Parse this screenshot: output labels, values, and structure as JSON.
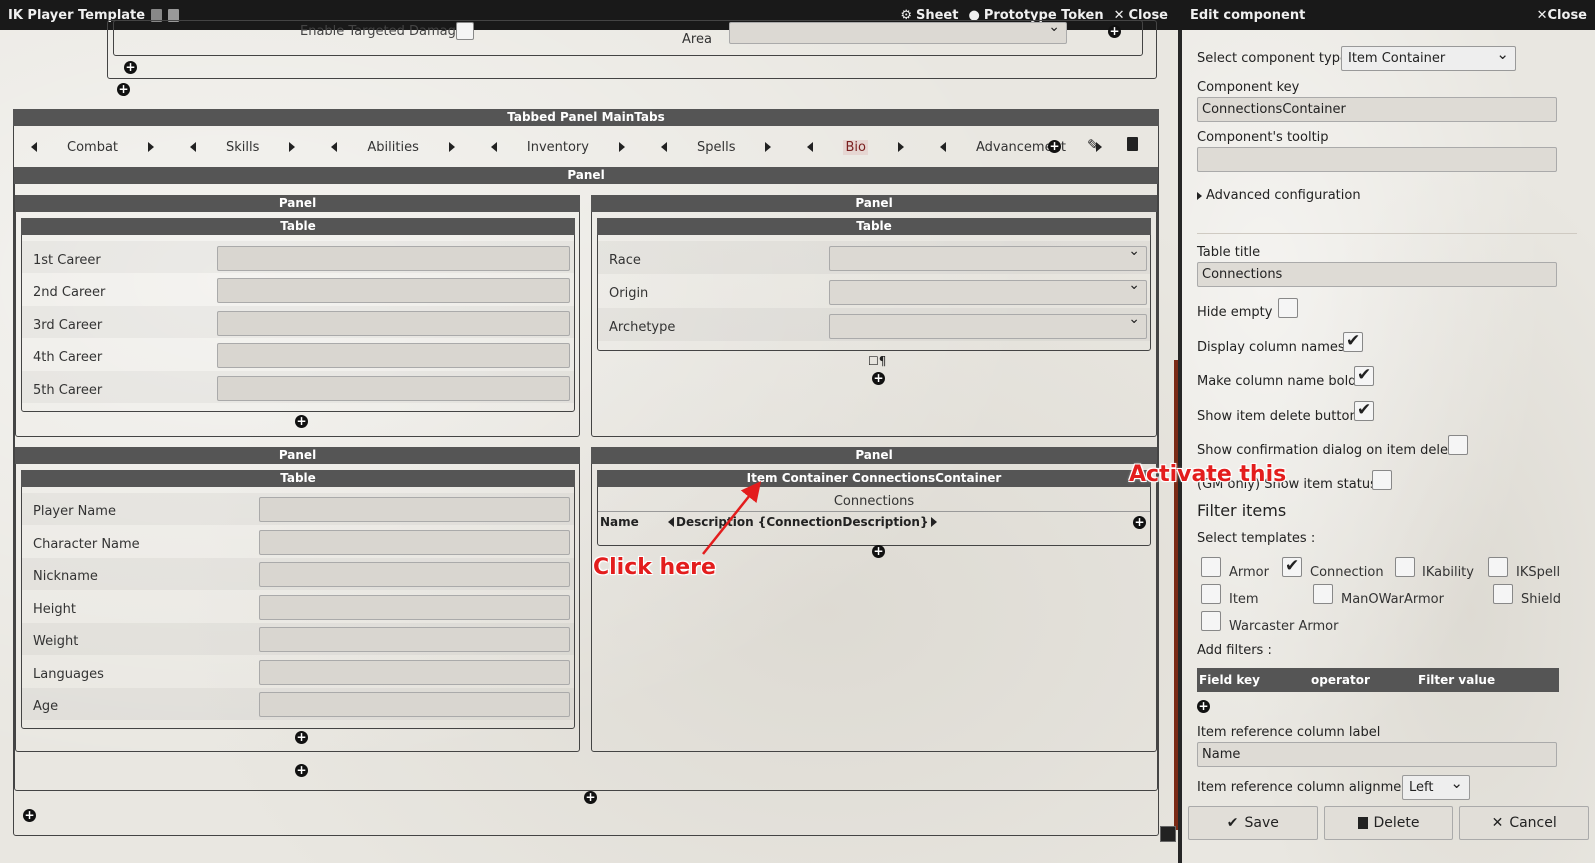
{
  "window": {
    "title": "IK Player Template",
    "sheet_label": "Sheet",
    "token_label": "Prototype Token",
    "close_label": "Close"
  },
  "top_fragment": {
    "targeted_damage_label": "Enable Targeted Damage",
    "area_label": "Area"
  },
  "tabbed_panel": {
    "title": "Tabbed Panel MainTabs",
    "tabs": [
      "Combat",
      "Skills",
      "Abilities",
      "Inventory",
      "Spells",
      "Bio",
      "Advancement"
    ],
    "active_tab": "Bio"
  },
  "main_panel_title": "Panel",
  "panel_tl": {
    "title": "Panel",
    "table_title": "Table",
    "rows": [
      "1st Career",
      "2nd Career",
      "3rd Career",
      "4th Career",
      "5th Career"
    ]
  },
  "panel_tr": {
    "title": "Panel",
    "table_title": "Table",
    "rows": [
      "Race",
      "Origin",
      "Archetype"
    ],
    "mini_icons": "☐¶"
  },
  "panel_bl": {
    "title": "Panel",
    "table_title": "Table",
    "rows": [
      "Player Name",
      "Character Name",
      "Nickname",
      "Height",
      "Weight",
      "Languages",
      "Age"
    ]
  },
  "panel_br": {
    "title": "Panel",
    "container_title": "Item Container ConnectionsContainer",
    "table_title": "Connections",
    "col_name": "Name",
    "col_description": "Description {ConnectionDescription}"
  },
  "annotations": {
    "click_here": "Click here",
    "activate_this": "Activate this"
  },
  "editor": {
    "header_title": "Edit component",
    "close_label": "Close",
    "component_type_label": "Select component type",
    "component_type_value": "Item Container",
    "component_key_label": "Component key",
    "component_key_value": "ConnectionsContainer",
    "tooltip_label": "Component's tooltip",
    "tooltip_value": "",
    "advanced_label": "Advanced configuration",
    "table_title_label": "Table title",
    "table_title_value": "Connections",
    "hide_empty_label": "Hide empty",
    "display_col_names_label": "Display column names",
    "bold_col_label": "Make column name bold",
    "show_delete_label": "Show item delete button",
    "confirm_delete_label": "Show confirmation dialog on item delete",
    "show_status_label": "(GM only) Show item status",
    "filter_items_heading": "Filter items",
    "select_templates_label": "Select templates :",
    "templates": {
      "armor": "Armor",
      "connection": "Connection",
      "ikability": "IKability",
      "ikspell": "IKSpell",
      "item": "Item",
      "manowararmor": "ManOWarArmor",
      "shield": "Shield",
      "warcaster_armor": "Warcaster Armor"
    },
    "add_filters_label": "Add filters :",
    "filter_cols": [
      "Field key",
      "operator",
      "Filter value"
    ],
    "ref_col_label_label": "Item reference column label",
    "ref_col_label_value": "Name",
    "ref_col_align_label": "Item reference column alignment",
    "ref_col_align_value": "Left",
    "save_label": "Save",
    "delete_label": "Delete",
    "cancel_label": "Cancel"
  }
}
